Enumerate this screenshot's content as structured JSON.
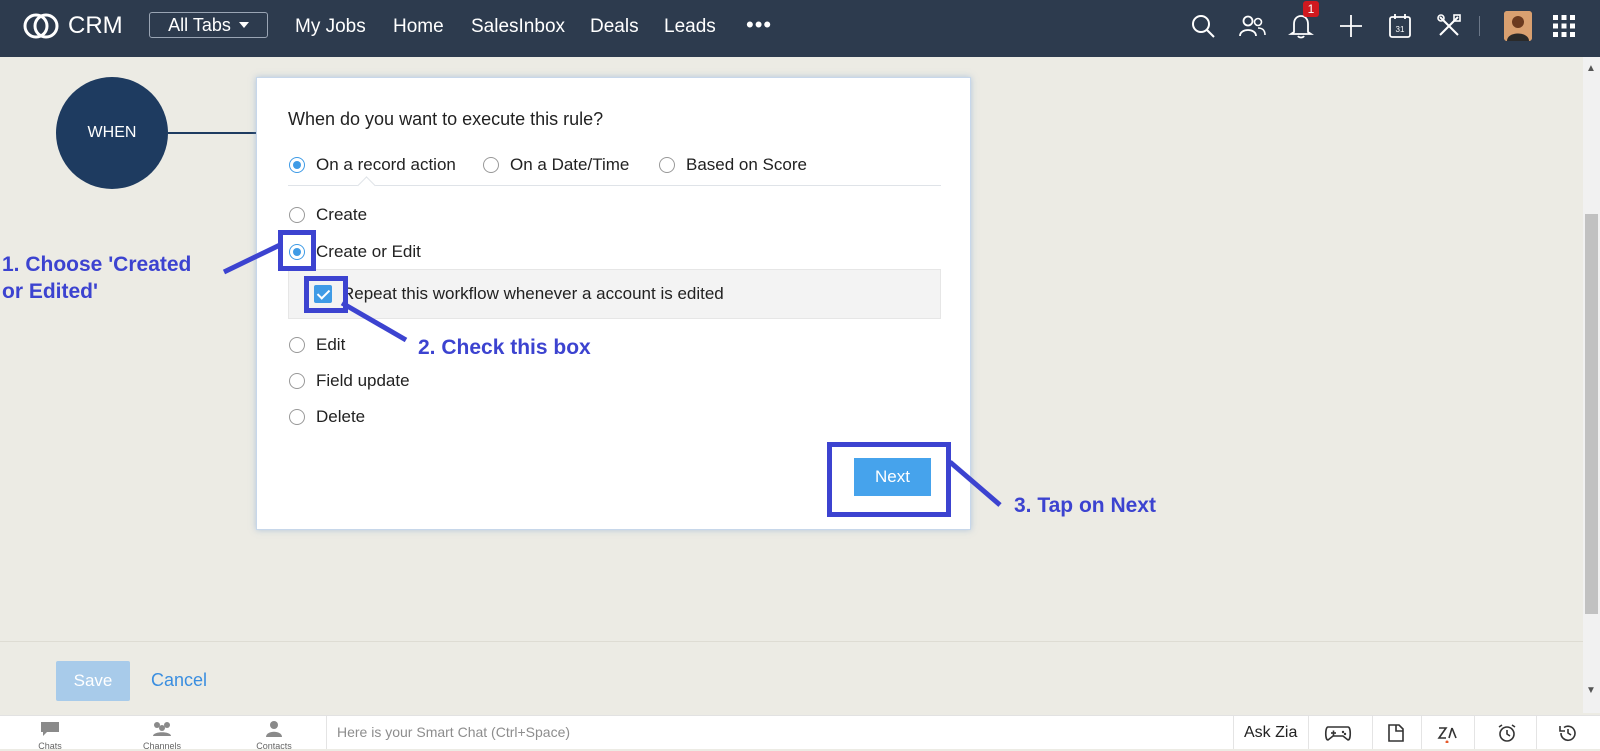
{
  "topbar": {
    "app_name": "CRM",
    "all_tabs_label": "All Tabs",
    "nav_items": [
      "My Jobs",
      "Home",
      "SalesInbox",
      "Deals",
      "Leads"
    ],
    "more_label": "•••",
    "notification_count": "1"
  },
  "rule": {
    "when_label": "WHEN",
    "question": "When do you want to execute this rule?",
    "trigger_types": [
      "On a record action",
      "On a Date/Time",
      "Based on Score"
    ],
    "selected_trigger": "On a record action",
    "actions": [
      "Create",
      "Create or Edit",
      "Edit",
      "Field update",
      "Delete"
    ],
    "selected_action": "Create or Edit",
    "repeat_label": "Repeat this workflow whenever a account is edited",
    "repeat_checked": true,
    "next_label": "Next"
  },
  "annotations": {
    "step1": "1. Choose 'Created or Edited'",
    "step1_line1": "1. Choose 'Created",
    "step1_line2": "or Edited'",
    "step2": "2. Check this box",
    "step3": "3. Tap on Next",
    "color": "#3c43d0"
  },
  "footer": {
    "save_label": "Save",
    "cancel_label": "Cancel"
  },
  "bottombar": {
    "chats_label": "Chats",
    "channels_label": "Channels",
    "contacts_label": "Contacts",
    "chat_placeholder": "Here is your Smart Chat (Ctrl+Space)",
    "ask_zia_label": "Ask Zia"
  },
  "colors": {
    "topbar_bg": "#2d3b4e",
    "accent": "#3f9be6",
    "when_circle": "#1e3b60"
  }
}
